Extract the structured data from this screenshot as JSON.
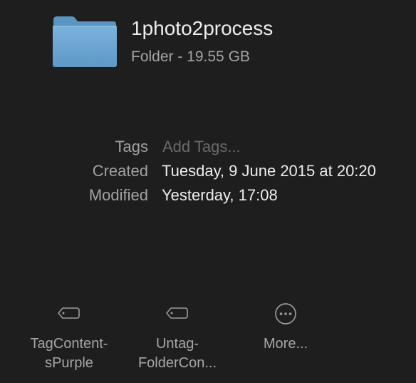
{
  "header": {
    "icon": "folder-icon",
    "name": "1photo2process",
    "kind": "Folder - 19.55 GB"
  },
  "info": {
    "tags": {
      "label": "Tags",
      "placeholder": "Add Tags..."
    },
    "created": {
      "label": "Created",
      "value": "Tuesday, 9 June 2015 at 20:20"
    },
    "modified": {
      "label": "Modified",
      "value": "Yesterday, 17:08"
    }
  },
  "actions": [
    {
      "icon": "tag-icon",
      "label_line1": "TagContent-",
      "label_line2": "sPurple"
    },
    {
      "icon": "tag-icon",
      "label_line1": "Untag-",
      "label_line2": "FolderCon..."
    },
    {
      "icon": "more-icon",
      "label_line1": "More...",
      "label_line2": ""
    }
  ],
  "colors": {
    "background": "#1e1e1e",
    "folder_blue": "#6fa6d0",
    "primary_text": "#ededed",
    "secondary_text": "#a4a4a4"
  }
}
